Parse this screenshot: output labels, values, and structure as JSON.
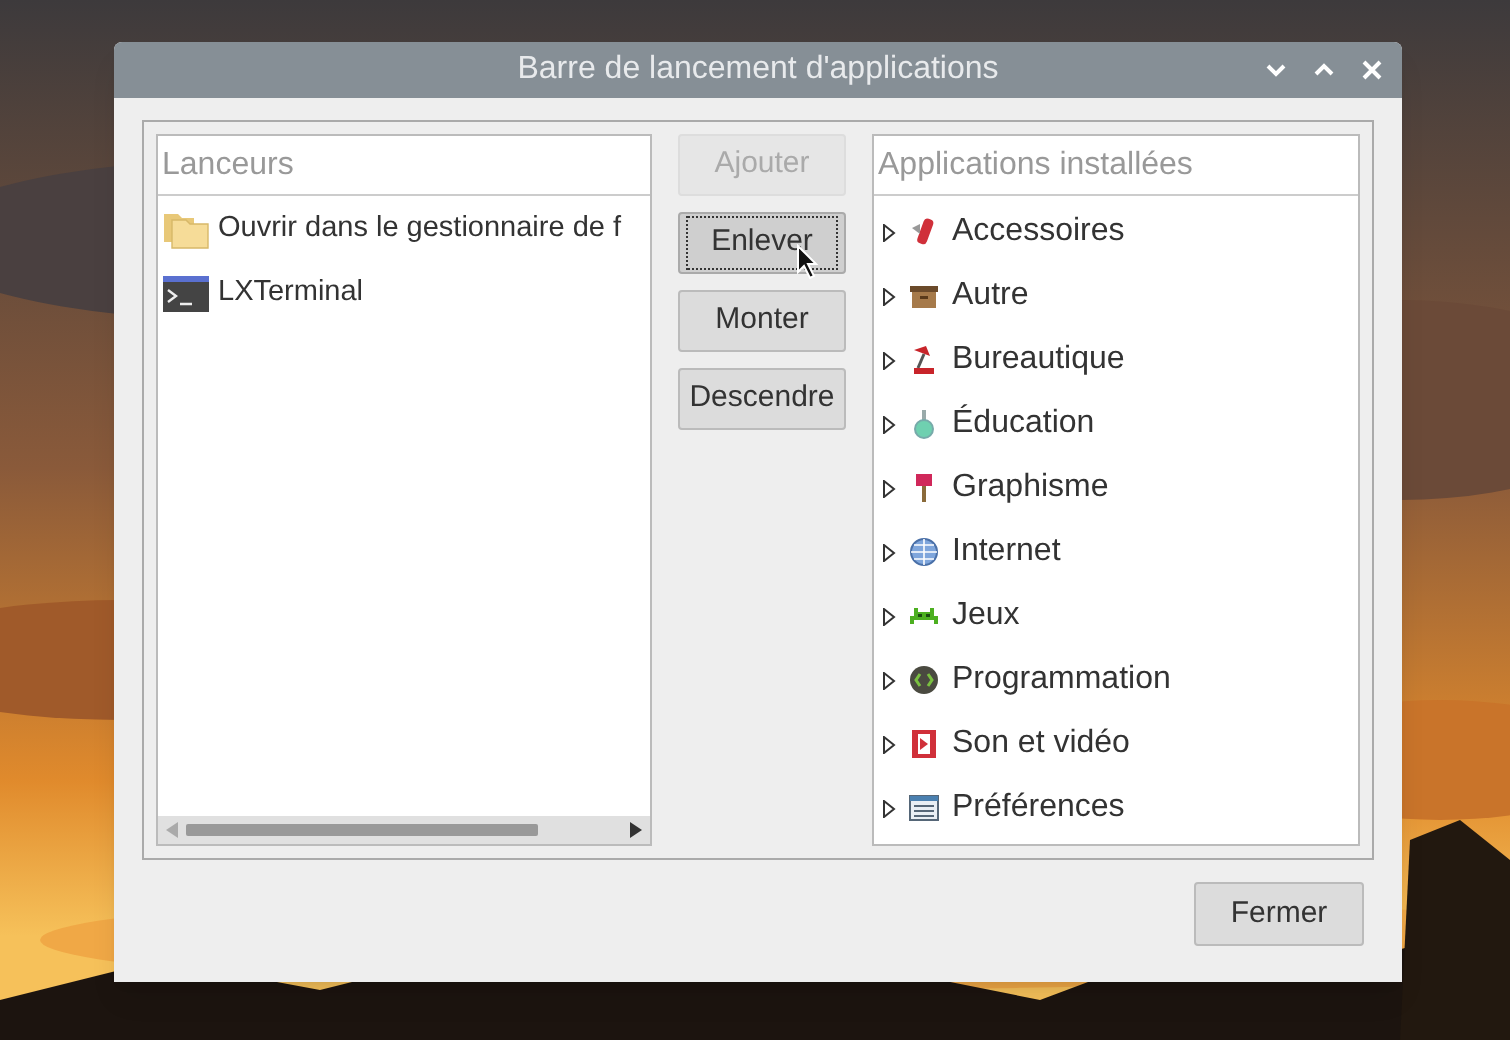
{
  "window": {
    "title": "Barre de lancement d'applications"
  },
  "launchers": {
    "header": "Lanceurs",
    "items": [
      {
        "kind": "folder",
        "label": "Ouvrir dans le gestionnaire de f"
      },
      {
        "kind": "terminal",
        "label": "LXTerminal"
      }
    ]
  },
  "buttons": [
    {
      "label": "Ajouter",
      "disabled": true,
      "focused": false,
      "hovered": false
    },
    {
      "label": "Enlever",
      "disabled": false,
      "focused": true,
      "hovered": true
    },
    {
      "label": "Monter",
      "disabled": false,
      "focused": false,
      "hovered": false
    },
    {
      "label": "Descendre",
      "disabled": false,
      "focused": false,
      "hovered": false
    }
  ],
  "installed": {
    "header": "Applications installées",
    "categories": [
      {
        "label": "Accessoires",
        "expanded": false
      },
      {
        "label": "Autre",
        "expanded": false
      },
      {
        "label": "Bureautique",
        "expanded": false
      },
      {
        "label": "Éducation",
        "expanded": false
      },
      {
        "label": "Graphisme",
        "expanded": false
      },
      {
        "label": "Internet",
        "expanded": false
      },
      {
        "label": "Jeux",
        "expanded": false
      },
      {
        "label": "Programmation",
        "expanded": false
      },
      {
        "label": "Son et vidéo",
        "expanded": false
      },
      {
        "label": "Préférences",
        "expanded": false
      }
    ]
  },
  "close_button": "Fermer"
}
